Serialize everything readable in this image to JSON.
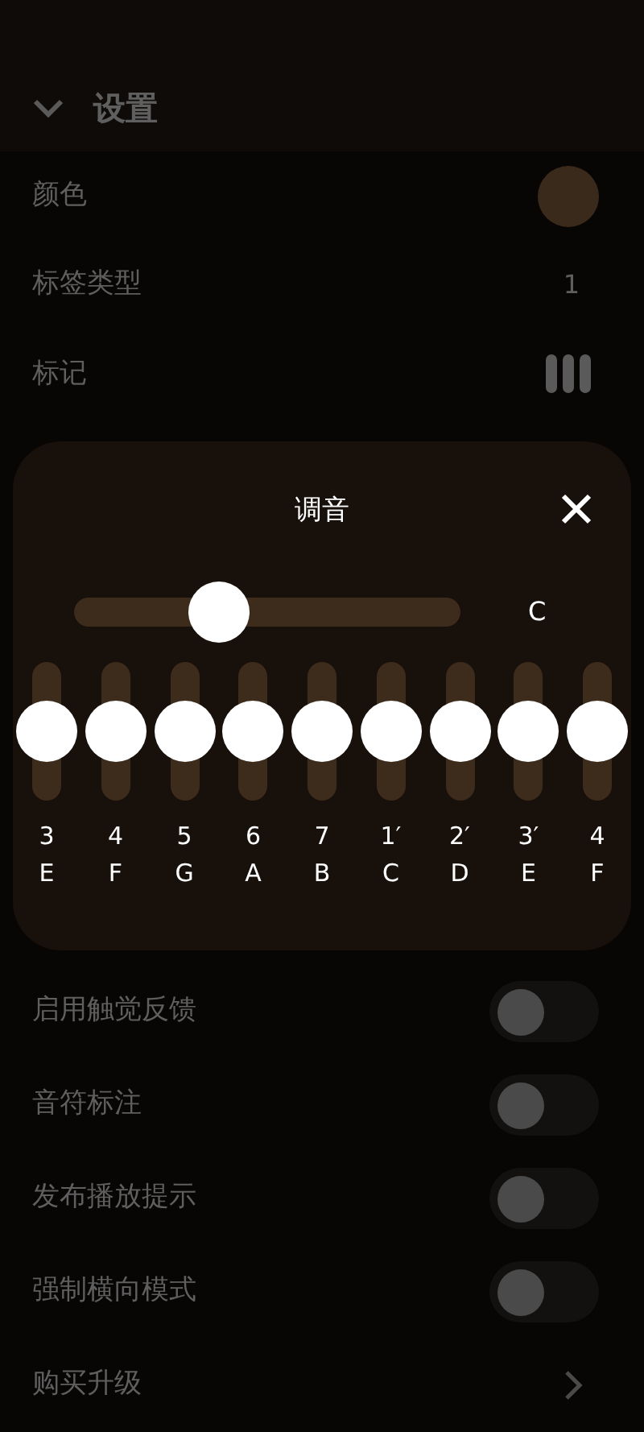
{
  "settings": {
    "title": "设置",
    "expanded": true,
    "rows": [
      {
        "kind": "color",
        "label": "颜色",
        "color": "#3a2a1b"
      },
      {
        "kind": "value",
        "label": "标签类型",
        "value": "1"
      },
      {
        "kind": "marker",
        "label": "标记"
      }
    ]
  },
  "tuning_dialog": {
    "title": "调音",
    "slider": {
      "level": 0.35,
      "reading": "C"
    },
    "notes": [
      {
        "number": "3",
        "letter": "E",
        "level": 0.5
      },
      {
        "number": "4",
        "letter": "F",
        "level": 0.5
      },
      {
        "number": "5",
        "letter": "G",
        "level": 0.5
      },
      {
        "number": "6",
        "letter": "A",
        "level": 0.5
      },
      {
        "number": "7",
        "letter": "B",
        "level": 0.5
      },
      {
        "number": "1′",
        "letter": "C",
        "level": 0.5
      },
      {
        "number": "2′",
        "letter": "D",
        "level": 0.5
      },
      {
        "number": "3′",
        "letter": "E",
        "level": 0.5
      },
      {
        "number": "4",
        "letter": "F",
        "level": 0.5
      }
    ]
  },
  "more_settings": [
    {
      "kind": "toggle",
      "label": "启用触觉反馈",
      "on": false
    },
    {
      "kind": "toggle",
      "label": "音符标注",
      "on": false
    },
    {
      "kind": "toggle",
      "label": "发布播放提示",
      "on": false
    },
    {
      "kind": "toggle",
      "label": "强制横向模式",
      "on": false
    },
    {
      "kind": "link",
      "label": "购买升级"
    }
  ]
}
